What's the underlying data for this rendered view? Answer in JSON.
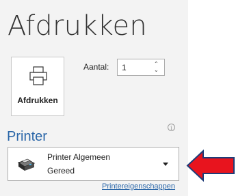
{
  "page": {
    "title": "Afdrukken"
  },
  "print_button": {
    "label": "Afdrukken",
    "icon": "printer-icon"
  },
  "copies": {
    "label": "Aantal:",
    "value": "1"
  },
  "printer_section": {
    "title": "Printer",
    "info_icon": "info-icon",
    "selected": {
      "name": "Printer Algemeen",
      "status": "Gereed",
      "icon": "printer-device-icon"
    },
    "properties_link": "Printereigenschappen"
  },
  "annotation": {
    "arrow_color": "#e8141e",
    "arrow_direction": "left"
  },
  "colors": {
    "accent": "#2a66a8",
    "panel_bg": "#f3f3f3"
  }
}
